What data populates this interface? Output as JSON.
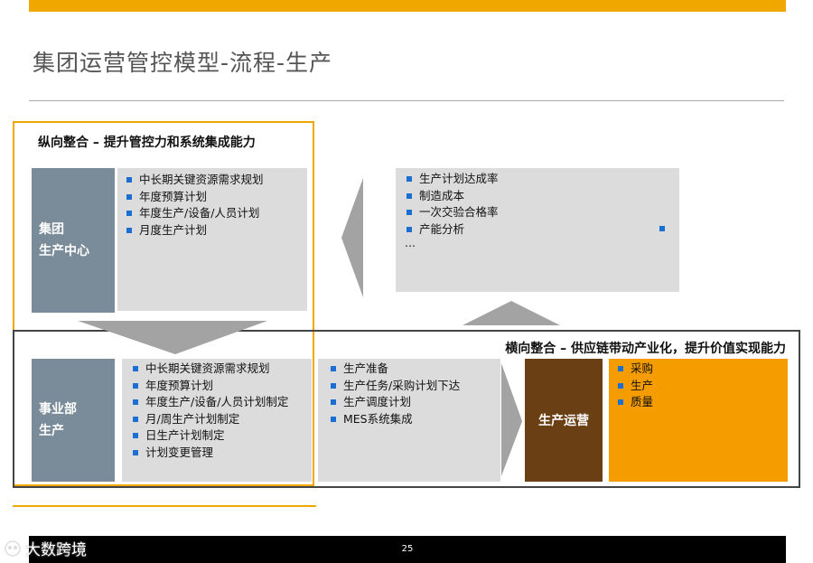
{
  "title": "集团运营管控模型-流程-生产",
  "vertical": {
    "title": "纵向整合 – 提升管控力和系统集成能力"
  },
  "horizontal": {
    "title": "横向整合 – 供应链带动产业化，提升价值实现能力"
  },
  "group_center": {
    "label_line1": "集团",
    "label_line2": "生产中心",
    "items": [
      "中长期关键资源需求规划",
      "年度预算计划",
      "年度生产/设备/人员计划",
      "月度生产计划"
    ]
  },
  "kpi_box": {
    "items": [
      "生产计划达成率",
      "制造成本",
      "一次交验合格率",
      "产能分析"
    ],
    "ellipsis": "…"
  },
  "business_unit": {
    "label_line1": "事业部",
    "label_line2": "生产",
    "items": [
      "中长期关键资源需求规划",
      "年度预算计划",
      "年度生产/设备/人员计划制定",
      "月/周生产计划制定",
      "日生产计划制定",
      "计划变更管理"
    ]
  },
  "execution": {
    "items": [
      "生产准备",
      "生产任务/采购计划下达",
      "生产调度计划",
      "MES系统集成"
    ]
  },
  "operations": {
    "label": "生产运营",
    "items": [
      "采购",
      "生产",
      "质量"
    ]
  },
  "footer": {
    "page_number": "25",
    "watermark": "大数跨境"
  },
  "colors": {
    "accent": "#f0a800",
    "slate": "#7a8b99",
    "brown": "#6b3f14",
    "orange": "#f59c00",
    "bullet": "#1a6fd0",
    "panel": "#dcdcdc"
  }
}
